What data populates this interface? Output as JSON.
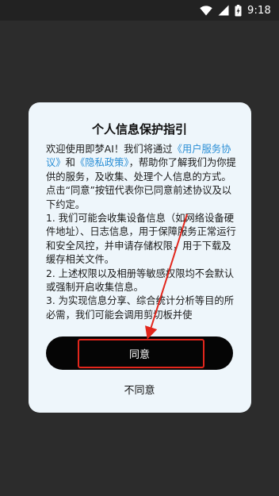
{
  "status_bar": {
    "time": "9:18",
    "icons": [
      "wifi-icon",
      "signal-icon",
      "battery-icon"
    ]
  },
  "dialog": {
    "title": "个人信息保护指引",
    "paragraph1": {
      "text1": "欢迎使用即梦AI！我们将通过",
      "link1": "《用户服务协议》",
      "text2": "和",
      "link2": "《隐私政策》",
      "text3": "，帮助你了解我们为你提供的服务，及收集、处理个人信息的方式。"
    },
    "paragraph2": "点击“同意”按钮代表你已同意前述协议及以下约定。",
    "item1": "1. 我们可能会收集设备信息（如网络设备硬件地址）、日志信息，用于保障服务正常运行和安全风控，并申请存储权限，用于下载及缓存相关文件。",
    "item2": "2. 上述权限以及相册等敏感权限均不会默认或强制开启收集信息。",
    "item3": "3. 为实现信息分享、综合统计分析等目的所必需，我们可能会调用剪切板并使",
    "agree_label": "同意",
    "disagree_label": "不同意"
  },
  "colors": {
    "link": "#2b8fd6",
    "dialog_bg": "#eef6fb",
    "overlay_bg": "#2c2c2c",
    "button_bg": "#050505",
    "annotation": "#e2261c"
  }
}
